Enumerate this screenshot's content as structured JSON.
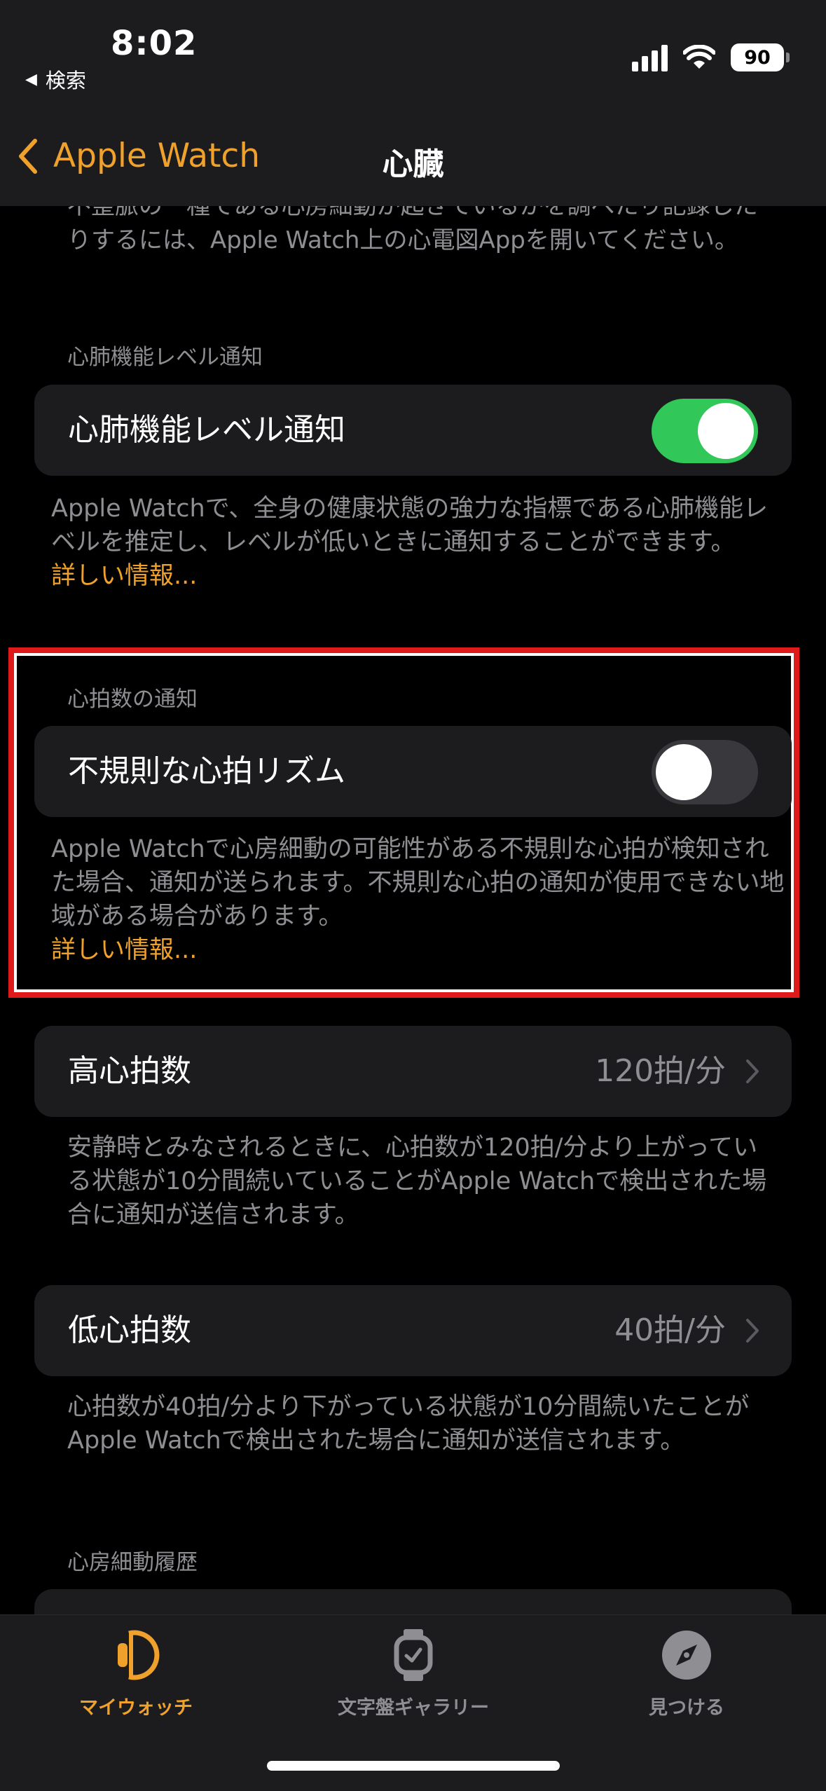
{
  "status_bar": {
    "time": "8:02",
    "back_label": "検索",
    "battery": "90"
  },
  "nav": {
    "back_label": "Apple Watch",
    "title": "心臓"
  },
  "top_cut_text": "不整脈の一種である心房細動が起きているかを調べたり記録したりするには、Apple Watch上の心電図Appを開いてください。",
  "cardio_section": {
    "header": "心肺機能レベル通知",
    "row_label": "心肺機能レベル通知",
    "toggle_on": true,
    "footer": "Apple Watchで、全身の健康状態の強力な指標である心肺機能レベルを推定し、レベルが低いときに通知することができます。",
    "more_link": "詳しい情報..."
  },
  "heart_rate_section": {
    "header": "心拍数の通知",
    "row_label": "不規則な心拍リズム",
    "toggle_on": false,
    "footer": "Apple Watchで心房細動の可能性がある不規則な心拍が検知された場合、通知が送られます。不規則な心拍の通知が使用できない地域がある場合があります。",
    "more_link": "詳しい情報..."
  },
  "high_hr": {
    "label": "高心拍数",
    "value": "120拍/分",
    "footer": "安静時とみなされるときに、心拍数が120拍/分より上がっている状態が10分間続いていることがApple Watchで検出された場合に通知が送信されます。"
  },
  "low_hr": {
    "label": "低心拍数",
    "value": "40拍/分",
    "footer": "心拍数が40拍/分より下がっている状態が10分間続いたことがApple Watchで検出された場合に通知が送信されます。"
  },
  "afib_history_header": "心房細動履歴",
  "tabs": [
    {
      "label": "マイウォッチ",
      "icon": "watch-side-icon",
      "active": true
    },
    {
      "label": "文字盤ギャラリー",
      "icon": "watch-face-icon",
      "active": false
    },
    {
      "label": "見つける",
      "icon": "compass-icon",
      "active": false
    }
  ],
  "colors": {
    "accent": "#f0a12c",
    "toggle_on": "#32c759",
    "highlight_border": "#e0191b",
    "card_bg": "#1c1c1e",
    "secondary_text": "#8e8e93"
  }
}
